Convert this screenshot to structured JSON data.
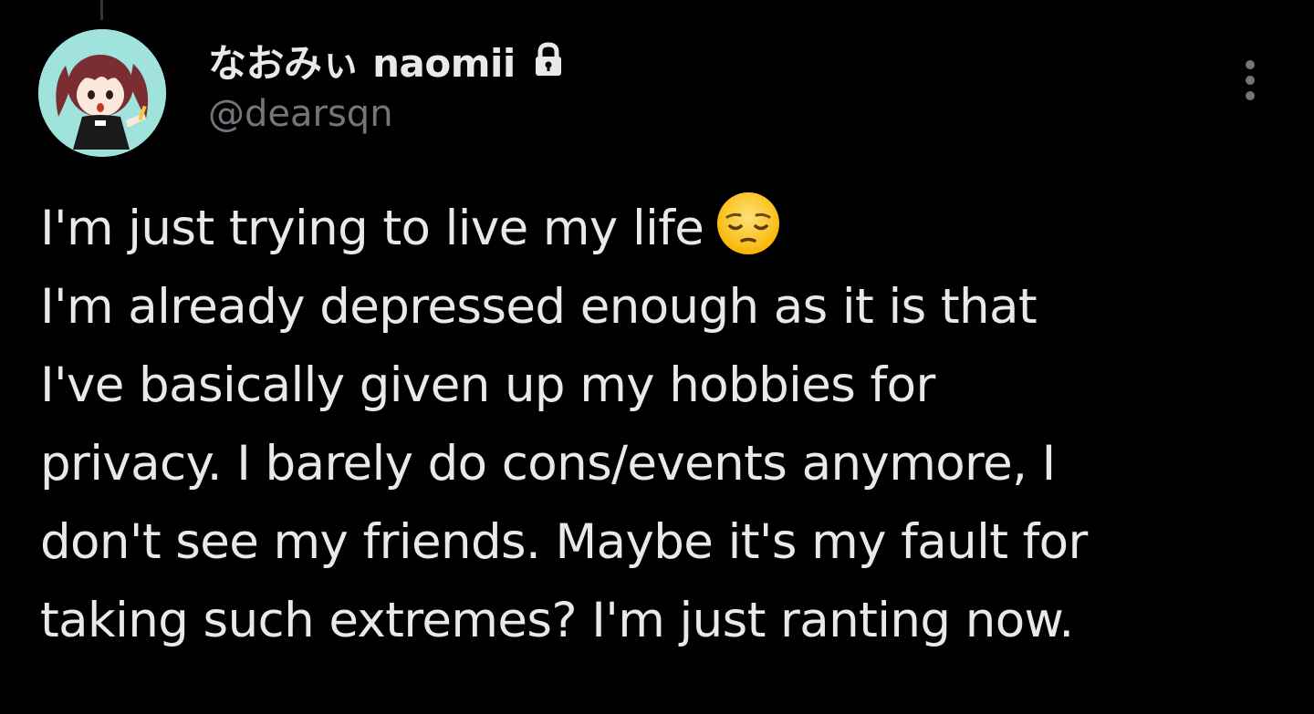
{
  "tweet": {
    "author": {
      "display_name": "なおみぃ naomii",
      "handle": "@dearsqn",
      "avatar_icon": "anime-avatar-icon",
      "protected_icon": "lock-icon"
    },
    "menu_icon": "more-vertical-icon",
    "text_lines": [
      "I'm just trying to live my life",
      "I'm already depressed enough as it is that",
      "I've basically given up my hobbies for",
      "privacy. I barely do cons/events anymore, I",
      "don't see my friends. Maybe it's my fault for",
      "taking such extremes? I'm just ranting now."
    ],
    "emoji": "pensive-face-emoji"
  },
  "theme": {
    "background": "#000000",
    "primary_text": "#e7e9ea",
    "secondary_text": "#71767b",
    "avatar_bg": "#9fe3dc"
  }
}
